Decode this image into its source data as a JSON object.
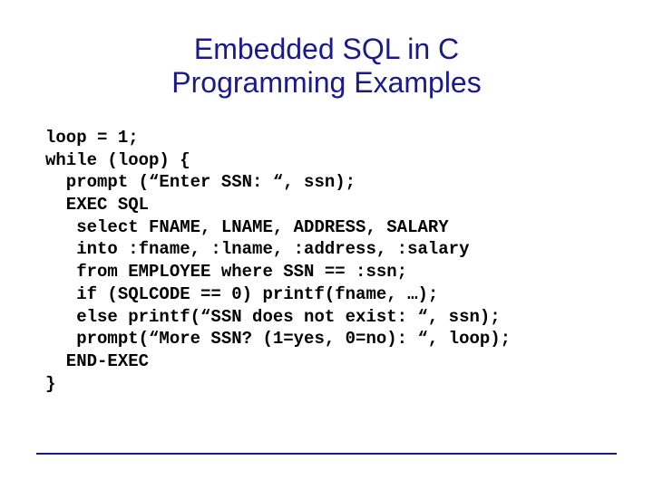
{
  "title_line1": "Embedded SQL in C",
  "title_line2": "Programming Examples",
  "code": {
    "l01": "loop = 1;",
    "l02": "while (loop) {",
    "l03": "  prompt (“Enter SSN: “, ssn);",
    "l04": "  EXEC SQL",
    "l05": "   select FNAME, LNAME, ADDRESS, SALARY",
    "l06": "   into :fname, :lname, :address, :salary",
    "l07": "   from EMPLOYEE where SSN == :ssn;",
    "l08": "   if (SQLCODE == 0) printf(fname, …);",
    "l09": "   else printf(“SSN does not exist: “, ssn);",
    "l10": "   prompt(“More SSN? (1=yes, 0=no): “, loop);",
    "l11": "  END-EXEC",
    "l12": "}"
  }
}
